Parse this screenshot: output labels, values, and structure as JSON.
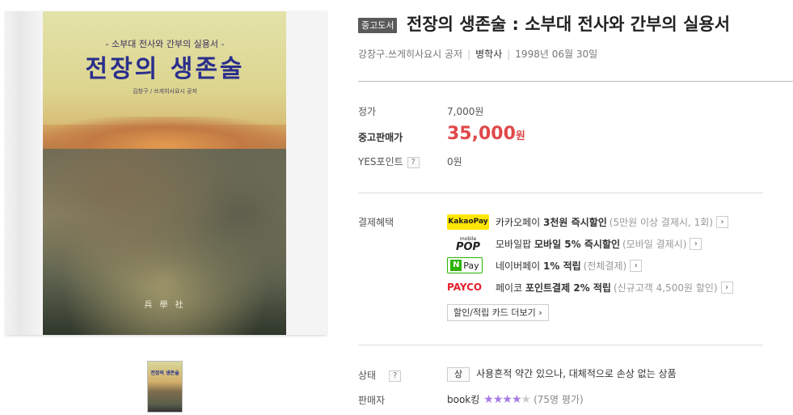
{
  "product_image": {
    "cover_subtitle": "- 소부대 전사와 간부의 실용서 -",
    "cover_title": "전장의 생존술",
    "cover_author": "김창구 / 쓰게히사요시 공저",
    "cover_publisher": "兵 學 社",
    "thumb_title": "전장의 생존술"
  },
  "header": {
    "badge": "중고도서",
    "title": "전장의 생존술 : 소부대 전사와 간부의 실용서",
    "authors": "강창구.쓰게히사요시 공저",
    "publisher": "병학사",
    "date": "1998년 06월 30일"
  },
  "pricing": {
    "list_price_label": "정가",
    "list_price": "7,000원",
    "sale_price_label": "중고판매가",
    "sale_price": "35,000",
    "sale_price_unit": "원",
    "points_label": "YES포인트",
    "points_help": "?",
    "points": "0원"
  },
  "payment": {
    "label": "결제혜택",
    "items": [
      {
        "logo": "KakaoPay",
        "main": "카카오페이 ",
        "strong": "3천원 즉시할인",
        "note": "(5만원 이상 결제시, 1회)"
      },
      {
        "logo_top": "mobile",
        "logo": "POP",
        "main": "모바일팝 ",
        "strong": "모바일 5% 즉시할인",
        "note": "(모바일 결제시)"
      },
      {
        "logo_n": "N",
        "logo": "Pay",
        "main": "네이버페이 ",
        "strong": "1% 적립",
        "note": "(전체결제)"
      },
      {
        "logo": "PAYCO",
        "main": "페이코 ",
        "strong": "포인트결제 2% 적립",
        "note": "(신규고객 4,500원 할인)"
      }
    ],
    "more_button": "할인/적립 카드 더보기"
  },
  "condition": {
    "label": "상태",
    "help": "?",
    "grade": "상",
    "description": "사용흔적 약간 있으나, 대체적으로 손상 없는 상품"
  },
  "seller": {
    "label": "판매자",
    "name": "book킹",
    "rating_stars": 4,
    "rating_max": 5,
    "reviews": "(75명 평가)"
  },
  "colors": {
    "price": "#e0484a",
    "stars": "#a77ce6",
    "kakao": "#ffe600",
    "npay": "#2db400",
    "payco": "#e4202b"
  }
}
